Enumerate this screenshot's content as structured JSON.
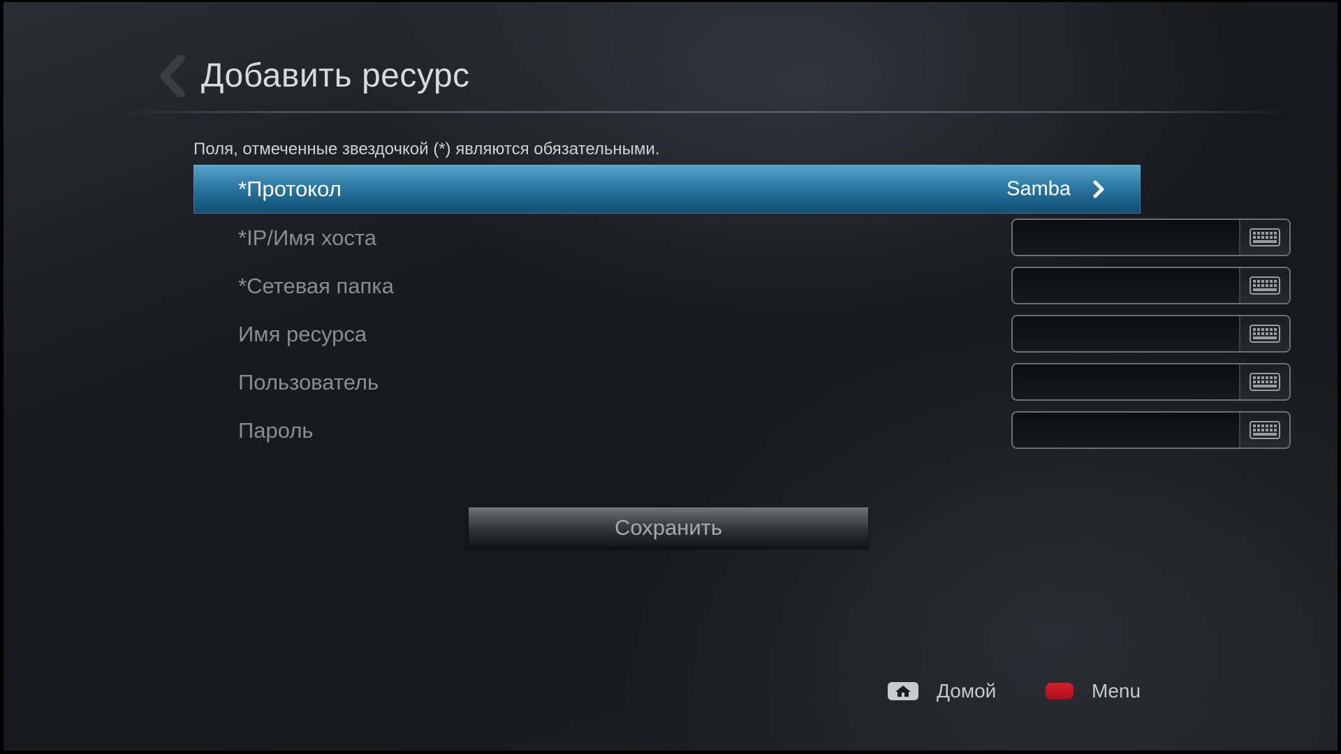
{
  "header": {
    "title": "Добавить ресурс",
    "back_icon": "chevron-left-icon"
  },
  "form": {
    "required_note": "Поля, отмеченные звездочкой (*) являются обязательными.",
    "protocol": {
      "label": "*Протокол",
      "value": "Samba",
      "icon": "chevron-right-icon"
    },
    "fields": [
      {
        "label": "*IP/Имя хоста",
        "value": "",
        "icon": "keyboard-icon"
      },
      {
        "label": "*Сетевая папка",
        "value": "",
        "icon": "keyboard-icon"
      },
      {
        "label": "Имя ресурса",
        "value": "",
        "icon": "keyboard-icon"
      },
      {
        "label": "Пользователь",
        "value": "",
        "icon": "keyboard-icon"
      },
      {
        "label": "Пароль",
        "value": "",
        "icon": "keyboard-icon"
      }
    ],
    "save_label": "Сохранить"
  },
  "footer": {
    "home": {
      "label": "Домой",
      "icon": "home-icon"
    },
    "menu": {
      "label": "Menu",
      "icon": "red-button-icon"
    }
  },
  "colors": {
    "selected_row": "#2f7ea8",
    "menu_key": "#d8202b"
  }
}
